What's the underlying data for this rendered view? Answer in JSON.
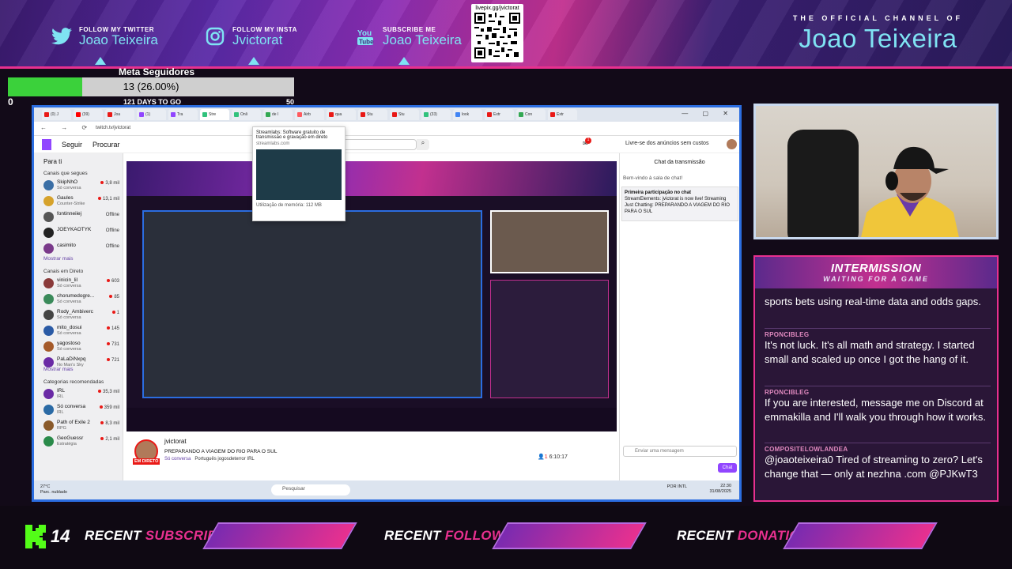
{
  "banner": {
    "twitter": {
      "label": "FOLLOW MY TWITTER",
      "name": "Joao Teixeira"
    },
    "insta": {
      "label": "FOLLOW MY INSTA",
      "name": "Jvictorat"
    },
    "youtube": {
      "label": "SUBSCRIBE ME",
      "name": "Joao Teixeira"
    },
    "qr_label": "livepix.gg/jvictorat",
    "channel_small": "THE OFFICIAL CHANNEL OF",
    "channel_big": "Joao Teixeira"
  },
  "goal": {
    "title": "Meta Seguidores",
    "value_text": "13 (26.00%)",
    "progress": 0.26,
    "min": "0",
    "max": "50",
    "days": "121 DAYS TO GO"
  },
  "browser": {
    "tabs": [
      "(0) J",
      "(39)",
      "Joa",
      "(1)",
      "Tra",
      "Stre",
      "Onli",
      "de l",
      "Airb",
      "qua",
      "Stu",
      "Stu",
      "(33)",
      "look",
      "Extr",
      "Con",
      "Extr"
    ],
    "url": "twitch.tv/jvictorat"
  },
  "twitch": {
    "follow_label": "Seguir",
    "browse_label": "Procurar",
    "notif_count": "1",
    "ads_label": "Livre-se dos anúncios sem custos",
    "for_you": "Para ti",
    "followed_header": "Canais que segues",
    "followed": [
      {
        "name": "SkipNhO",
        "sub": "Só conversa",
        "viewers": "3,8 mil",
        "color": "#3a6ea5"
      },
      {
        "name": "Gaules",
        "sub": "Counter-Strike",
        "viewers": "13,1 mil",
        "color": "#d6a22b"
      },
      {
        "name": "fontinneiiej",
        "sub": "",
        "viewers": "Offline",
        "color": "#555"
      },
      {
        "name": "JOEYKAOTYK",
        "sub": "",
        "viewers": "Offline",
        "color": "#222"
      },
      {
        "name": "casimito",
        "sub": "",
        "viewers": "Offline",
        "color": "#7a3a8a"
      }
    ],
    "show_more": "Mostrar mais",
    "live_header": "Canais em Direto",
    "live": [
      {
        "name": "vinicin_lil",
        "sub": "Só conversa",
        "viewers": "603",
        "color": "#8a3a3a"
      },
      {
        "name": "chorumedogre...",
        "sub": "Só conversa",
        "viewers": "85",
        "color": "#3a8a5a"
      },
      {
        "name": "Rody_Ambiverc",
        "sub": "Só conversa",
        "viewers": "1",
        "color": "#444"
      },
      {
        "name": "mito_dosui",
        "sub": "Só conversa",
        "viewers": "145",
        "color": "#2a5aa5"
      },
      {
        "name": "yagostoso",
        "sub": "Só conversa",
        "viewers": "731",
        "color": "#a55a2a"
      },
      {
        "name": "PaLaDiNxpq",
        "sub": "No Man's Sky",
        "viewers": "721",
        "color": "#6a2aa5"
      }
    ],
    "show_more2": "Mostrar mais",
    "rec_header": "Categorias recomendadas",
    "categories": [
      {
        "name": "IRL",
        "sub": "IRL",
        "viewers": "35,3 mil",
        "color": "#6a2aa5"
      },
      {
        "name": "Só conversa",
        "sub": "IRL",
        "viewers": "359 mil",
        "color": "#2a6aa5"
      },
      {
        "name": "Path of Exile 2",
        "sub": "RPG",
        "viewers": "8,3 mil",
        "color": "#8a5a2a"
      },
      {
        "name": "GeoGuessr",
        "sub": "Estratégia",
        "viewers": "2,1 mil",
        "color": "#2a8a4a"
      }
    ],
    "popup_title": "Streamlabs: Software gratuito de transmissão e gravação em direto",
    "popup_url": "streamlabs.com",
    "popup_mem": "Utilização de memória: 112 MB",
    "chat_title": "Chat da transmissão",
    "chat_welcome": "Bem-vindo à sala de chat!",
    "first_time": "Primeira participação no chat",
    "se_msg": "StreamElements: jvictorat is now live! Streaming Just Chatting: PREPARANDO A VIAGEM DO RIO PARA O SUL",
    "chat_placeholder": "Enviar uma mensagem",
    "chat_button": "Chat",
    "channel": "jvictorat",
    "stream_title": "PREPARANDO A VIAGEM DO RIO PARA O SUL",
    "stream_cat": "Só conversa",
    "tags": "Português   jogosdeterror   IRL",
    "live_badge": "EM DIRETO",
    "viewers": "1",
    "uptime": "6:10:17"
  },
  "taskbar": {
    "weather": "27°C",
    "weather_sub": "Parc. nublado",
    "search": "Pesquisar",
    "lang": "POR INTL",
    "time": "22:30",
    "date": "31/08/2025"
  },
  "intermission": {
    "title": "INTERMISSION",
    "subtitle": "WAITING FOR A GAME",
    "messages": [
      {
        "user": "",
        "text": "sports bets using real-time data and odds gaps."
      },
      {
        "user": "RPONCIBLEG",
        "text": "It's not luck. It's all math and strategy. I started small and scaled up once I got the hang of it."
      },
      {
        "user": "RPONCIBLEG",
        "text": "If you are interested, message me on Discord at emmakilla and I'll walk you through how it works."
      },
      {
        "user": "COMPOSITELOWLANDEA",
        "text": "@joaoteixeira0 Tired of streaming to zero? Let's change that — only at nezhna .com @PJKwT3"
      }
    ]
  },
  "footer": {
    "logo": "14",
    "recent": "RECENT",
    "subscriber": "SUBSCRIBER",
    "follower": "FOLLOWER",
    "donation": "DONATION"
  },
  "colors": {
    "accent_pink": "#e8308f",
    "accent_cyan": "#7fe3f3",
    "twitch_purple": "#9146ff"
  }
}
